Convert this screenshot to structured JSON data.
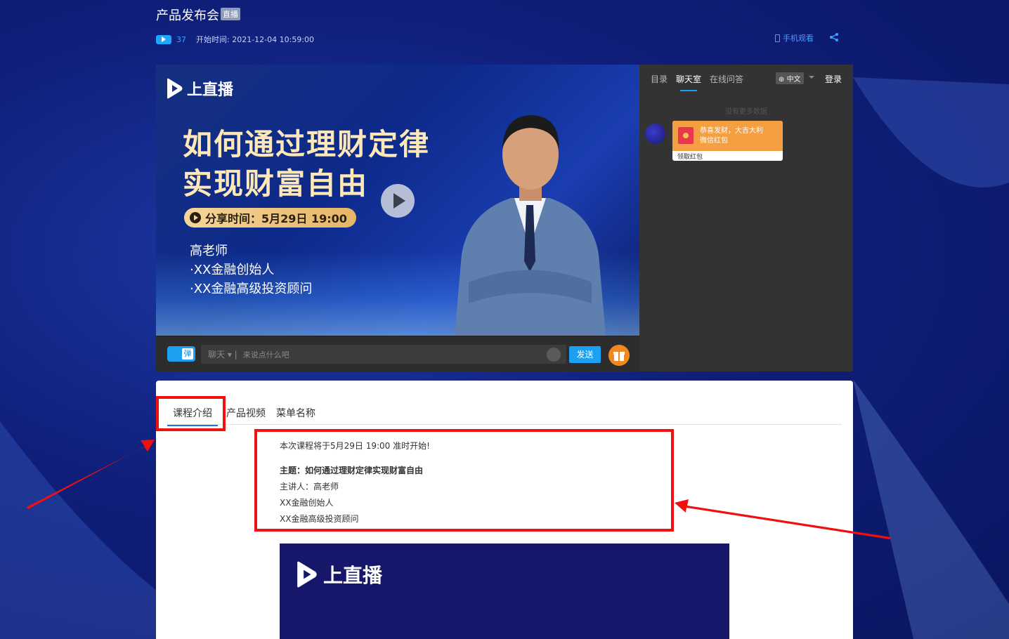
{
  "header": {
    "title": "产品发布会",
    "live_tag": "直播",
    "view_count": "37",
    "start_time": "开始时间: 2021-12-04 10:59:00",
    "mobile_watch": "手机观看"
  },
  "player": {
    "brand": "上直播",
    "headline_line1": "如何通过理财定律",
    "headline_line2": "实现财富自由",
    "share_time": "分享时间：5月29日 19:00",
    "teacher_name": "高老师",
    "teacher_line1": "·XX金融创始人",
    "teacher_line2": "·XX金融高级投资顾问"
  },
  "chatbar": {
    "danmu_label": "弹",
    "chat_type": "聊天 ▾ |",
    "placeholder": "来说点什么吧",
    "send_label": "发送"
  },
  "sidebar": {
    "tabs": [
      {
        "label": "目录"
      },
      {
        "label": "聊天室"
      },
      {
        "label": "在线问答"
      }
    ],
    "language": "中文",
    "login": "登录",
    "no_more": "没有更多数据",
    "redpacket": {
      "line1": "恭喜发财，大吉大利",
      "line2": "微信红包",
      "footer": "领取红包"
    }
  },
  "content": {
    "tabs": [
      {
        "label": "课程介绍"
      },
      {
        "label": "产品视频"
      },
      {
        "label": "菜单名称"
      }
    ],
    "intro": {
      "line1": "本次课程将于5月29日 19:00 准时开始!",
      "theme": "主题：如何通过理财定律实现财富自由",
      "speaker": "主讲人：高老师",
      "role1": "XX金融创始人",
      "role2": "XX金融高级投资顾问"
    },
    "banner_brand": "上直播"
  },
  "colors": {
    "accent": "#1ea0f0",
    "highlight": "#f01010",
    "background": "#0f1f7a"
  }
}
